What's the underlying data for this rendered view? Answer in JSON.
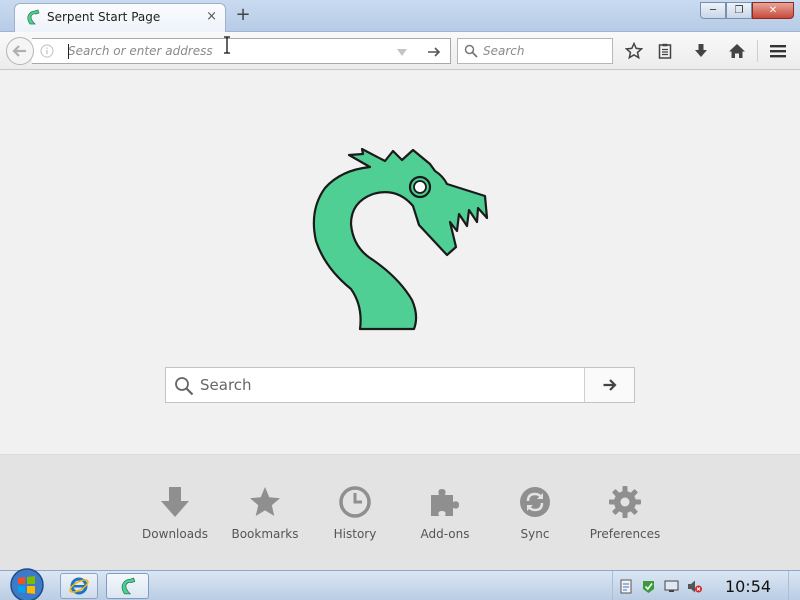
{
  "window": {
    "tab_title": "Serpent Start Page",
    "tab_close": "×",
    "new_tab": "+",
    "controls": {
      "minimize": "─",
      "restore": "❐",
      "close": "✕"
    }
  },
  "navbar": {
    "url_placeholder": "Search or enter address",
    "url_value": "",
    "search_placeholder": "Search"
  },
  "main": {
    "search_placeholder": "Search",
    "brand_color": "#4fcf93",
    "outline_color": "#1a1a1a"
  },
  "launcher": {
    "items": [
      {
        "label": "Downloads",
        "icon": "download-icon"
      },
      {
        "label": "Bookmarks",
        "icon": "star-icon"
      },
      {
        "label": "History",
        "icon": "clock-icon"
      },
      {
        "label": "Add-ons",
        "icon": "puzzle-icon"
      },
      {
        "label": "Sync",
        "icon": "sync-icon"
      },
      {
        "label": "Preferences",
        "icon": "gear-icon"
      }
    ],
    "icon_color": "#8f8f8f"
  },
  "taskbar": {
    "clock": "10:54"
  }
}
